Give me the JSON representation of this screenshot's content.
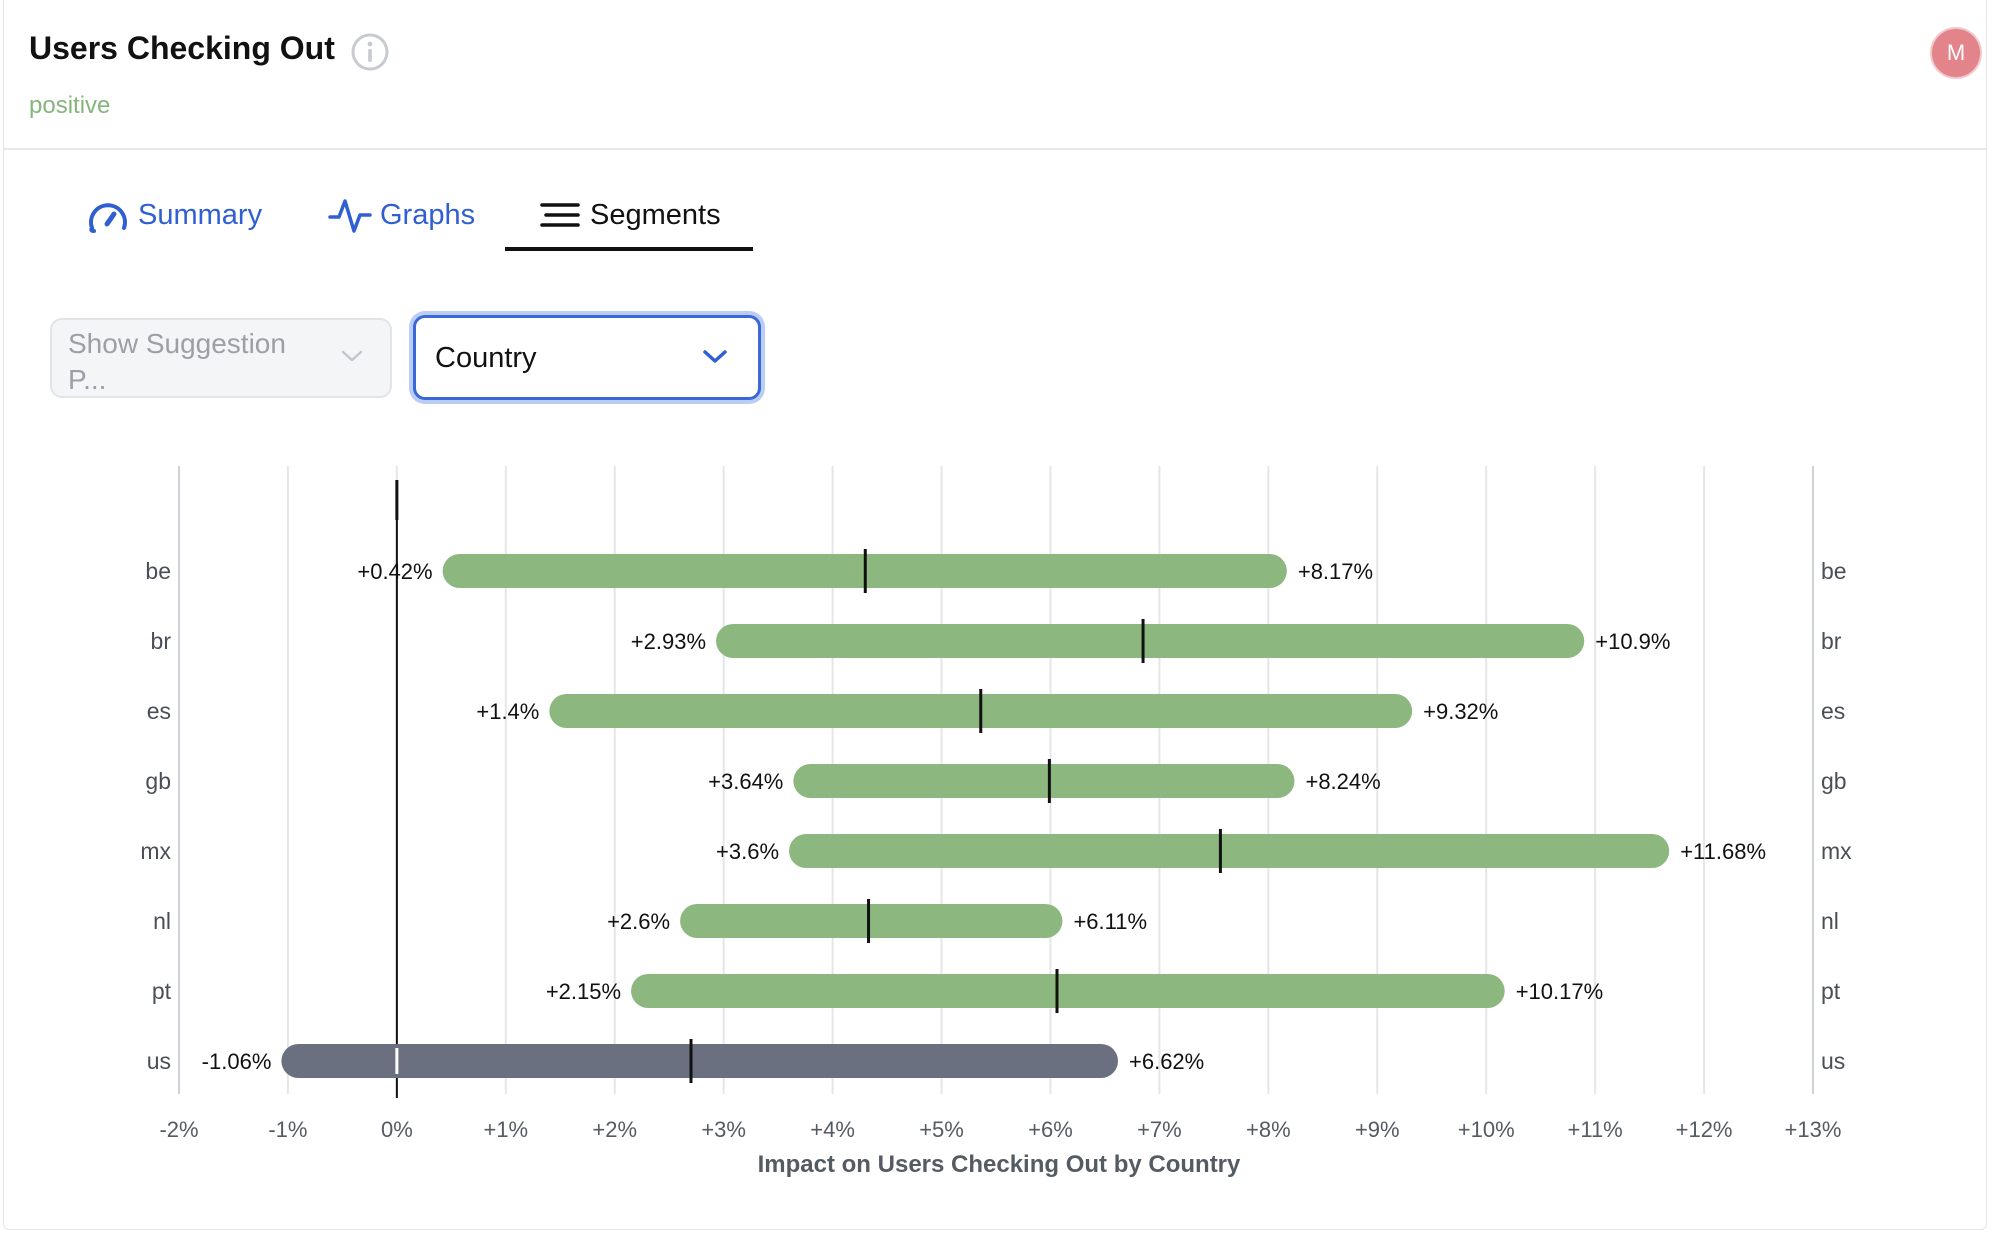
{
  "header": {
    "title": "Users Checking Out",
    "info_icon": "info-circle-icon",
    "subtitle": "positive",
    "avatar_initial": "M",
    "avatar_color": "#e3838a"
  },
  "tabs": [
    {
      "label": "Summary",
      "icon": "gauge-icon",
      "active": false
    },
    {
      "label": "Graphs",
      "icon": "pulse-line-icon",
      "active": false
    },
    {
      "label": "Segments",
      "icon": "list-lines-icon",
      "active": true
    }
  ],
  "controls": {
    "suggestion_dropdown": {
      "value": "Show Suggestion P...",
      "disabled": true
    },
    "segment_dropdown": {
      "value": "Country"
    }
  },
  "colors": {
    "positive_bar": "#8cb87f",
    "negative_bar": "#6b7080",
    "accent": "#2f5fd0",
    "subtitle": "#86b57c"
  },
  "chart_data": {
    "type": "bar",
    "orientation": "horizontal-range",
    "xlabel": "Impact on Users Checking Out by Country",
    "x_ticks": [
      "-2%",
      "-1%",
      "0%",
      "+1%",
      "+2%",
      "+3%",
      "+4%",
      "+5%",
      "+6%",
      "+7%",
      "+8%",
      "+9%",
      "+10%",
      "+11%",
      "+12%",
      "+13%"
    ],
    "xlim": [
      -2,
      13
    ],
    "categories": [
      "be",
      "br",
      "es",
      "gb",
      "mx",
      "nl",
      "pt",
      "us"
    ],
    "low": [
      0.42,
      2.93,
      1.4,
      3.64,
      3.6,
      2.6,
      2.15,
      -1.06
    ],
    "high": [
      8.17,
      10.9,
      9.32,
      8.24,
      11.68,
      6.11,
      10.17,
      6.62
    ],
    "mid": [
      4.3,
      6.85,
      5.36,
      5.99,
      7.56,
      4.33,
      6.06,
      2.7
    ],
    "low_labels": [
      "+0.42%",
      "+2.93%",
      "+1.4%",
      "+3.64%",
      "+3.6%",
      "+2.6%",
      "+2.15%",
      "-1.06%"
    ],
    "high_labels": [
      "+8.17%",
      "+10.9%",
      "+9.32%",
      "+8.24%",
      "+11.68%",
      "+6.11%",
      "+10.17%",
      "+6.62%"
    ],
    "grid": true
  }
}
